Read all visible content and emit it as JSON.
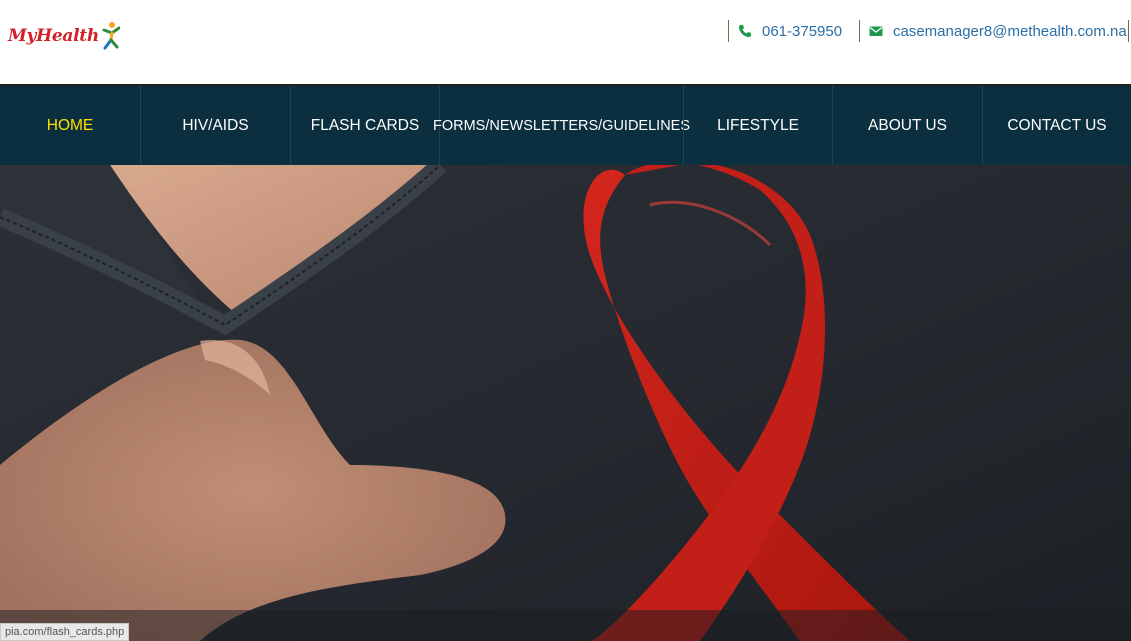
{
  "brand": {
    "logo_text_my": "My",
    "logo_text_health": "Health",
    "logo_figure": "person-figure-icon"
  },
  "contact": {
    "phone": "061-375950",
    "phone_icon": "phone-icon",
    "email": "casemanager8@methealth.com.na",
    "email_icon": "envelope-icon",
    "icon_color": "#1a9a4a",
    "text_color": "#2a6fa8"
  },
  "nav": {
    "items": [
      {
        "label": "HOME",
        "active": true
      },
      {
        "label": "HIV/AIDS",
        "active": false
      },
      {
        "label": "FLASH CARDS",
        "active": false
      },
      {
        "label": "FORMS/NEWSLETTERS/GUIDELINES",
        "active": false
      },
      {
        "label": "LIFESTYLE",
        "active": false
      },
      {
        "label": "ABOUT US",
        "active": false
      },
      {
        "label": "CONTACT US",
        "active": false
      }
    ],
    "background": "#0b2f3e",
    "active_color": "#ffe100"
  },
  "hero": {
    "subject": "red-ribbon-photo"
  },
  "status_bar": {
    "text": "pia.com/flash_cards.php"
  }
}
